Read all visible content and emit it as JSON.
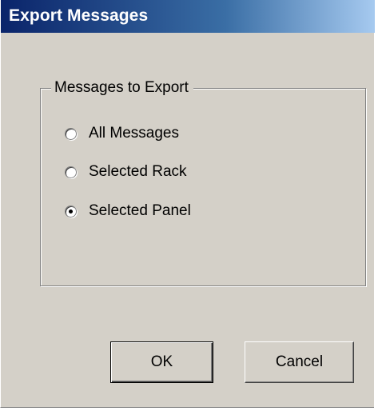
{
  "window": {
    "title": "Export Messages"
  },
  "group": {
    "legend": "Messages to Export",
    "options": [
      {
        "label": "All Messages",
        "checked": false
      },
      {
        "label": "Selected Rack",
        "checked": false
      },
      {
        "label": "Selected Panel",
        "checked": true
      }
    ]
  },
  "buttons": {
    "ok_label": "OK",
    "cancel_label": "Cancel"
  },
  "colors": {
    "title_bar_start": "#0a246a",
    "title_bar_end": "#a6caf0",
    "dialog_face": "#d4d0c8"
  }
}
